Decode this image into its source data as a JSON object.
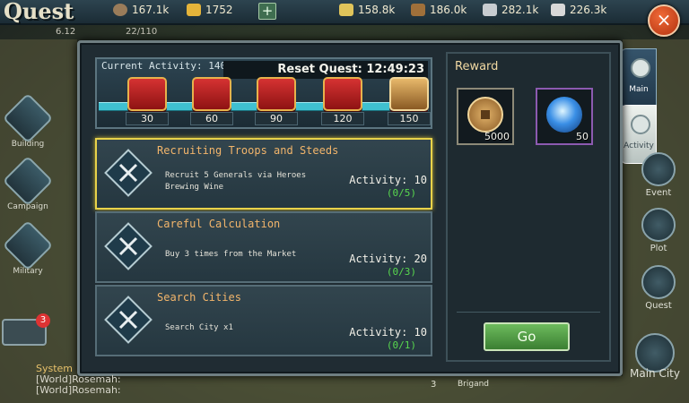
{
  "header": {
    "title": "Quest",
    "resources": [
      {
        "icon": "coin-icon",
        "value": "167.1k",
        "color": "#9a7c5a"
      },
      {
        "icon": "gold-ingot-icon",
        "value": "1752",
        "color": "#e5b43a"
      },
      {
        "icon": "wheat-icon",
        "value": "158.8k",
        "color": "#e0c45a"
      },
      {
        "icon": "lumber-icon",
        "value": "186.0k",
        "color": "#a0703a"
      },
      {
        "icon": "iron-ore-icon",
        "value": "282.1k",
        "color": "#c8ccd0"
      },
      {
        "icon": "axe-icon",
        "value": "226.3k",
        "color": "#d8d8d8"
      }
    ],
    "add_label": "+",
    "close_label": "×",
    "sub_left": "6.12",
    "sub_right": "22/110"
  },
  "side_left": [
    {
      "label": "Building",
      "icon": "building-icon"
    },
    {
      "label": "Campaign",
      "icon": "campaign-flag-icon"
    },
    {
      "label": "Military",
      "icon": "military-icon"
    }
  ],
  "side_right": [
    {
      "label": "Event",
      "icon": "event-icon"
    },
    {
      "label": "Plot",
      "icon": "plot-icon"
    },
    {
      "label": "Quest",
      "icon": "quest-icon"
    },
    {
      "label": "Main City",
      "icon": "main-city-icon"
    }
  ],
  "tabs": [
    {
      "label": "Main"
    },
    {
      "label": "Activity"
    }
  ],
  "activity": {
    "current_label": "Current Activity: 140",
    "reset_label": "Reset Quest: 12:49:23",
    "chests": [
      {
        "threshold": "30"
      },
      {
        "threshold": "60"
      },
      {
        "threshold": "90"
      },
      {
        "threshold": "120"
      },
      {
        "threshold": "150"
      }
    ]
  },
  "quests": [
    {
      "name": "Recruiting Troops and Steeds",
      "description_line1": "Recruit 5 Generals via Heroes",
      "description_line2": "Brewing Wine",
      "activity": "Activity: 10",
      "progress": "(0/5)"
    },
    {
      "name": "Careful Calculation",
      "description_line1": "Buy 3 times from the Market",
      "description_line2": "",
      "activity": "Activity: 20",
      "progress": "(0/3)"
    },
    {
      "name": "Search Cities",
      "description_line1": "Search City x1",
      "description_line2": "",
      "activity": "Activity: 10",
      "progress": "(0/1)"
    }
  ],
  "reward": {
    "title": "Reward",
    "items": [
      {
        "icon": "copper-coin-icon",
        "qty": "5000"
      },
      {
        "icon": "blue-orb-icon",
        "qty": "50"
      }
    ],
    "go_label": "Go"
  },
  "chat": {
    "badge": "3",
    "lines": [
      "System",
      "[World]Rosemah:",
      "[World]Rosemah:"
    ],
    "marker": "3",
    "place": "Brigand"
  }
}
